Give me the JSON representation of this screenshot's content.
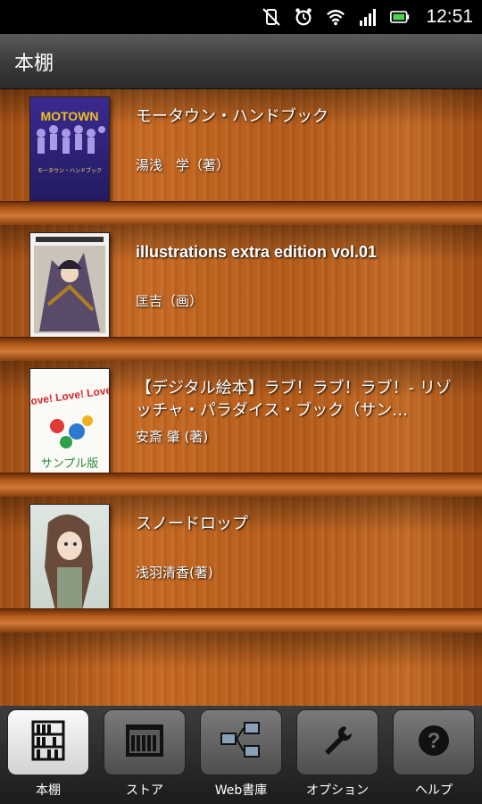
{
  "status": {
    "time": "12:51"
  },
  "header": {
    "title": "本棚"
  },
  "books": [
    {
      "title": "モータウン・ハンドブック",
      "author": "湯浅　学（著）",
      "cover_text": "MOTOWN",
      "cover_subtext": "モータウン・ハンドブック"
    },
    {
      "title": "illustrations extra edition vol.01",
      "author": "匡吉（画）"
    },
    {
      "title": "【デジタル絵本】ラブ！ラブ！ラブ！- リゾッチャ・パラダイス・ブック（サン…",
      "author": "安斎 肇 (著)",
      "cover_text": "Love! Love! Love!",
      "cover_subtext": "サンプル版"
    },
    {
      "title": "スノードロップ",
      "author": "浅羽清香(著)"
    }
  ],
  "nav": [
    {
      "label": "本棚",
      "icon": "bookshelf-icon",
      "active": true
    },
    {
      "label": "ストア",
      "icon": "store-icon",
      "active": false
    },
    {
      "label": "Web書庫",
      "icon": "network-icon",
      "active": false
    },
    {
      "label": "オプション",
      "icon": "wrench-icon",
      "active": false
    },
    {
      "label": "ヘルプ",
      "icon": "help-icon",
      "active": false
    }
  ]
}
